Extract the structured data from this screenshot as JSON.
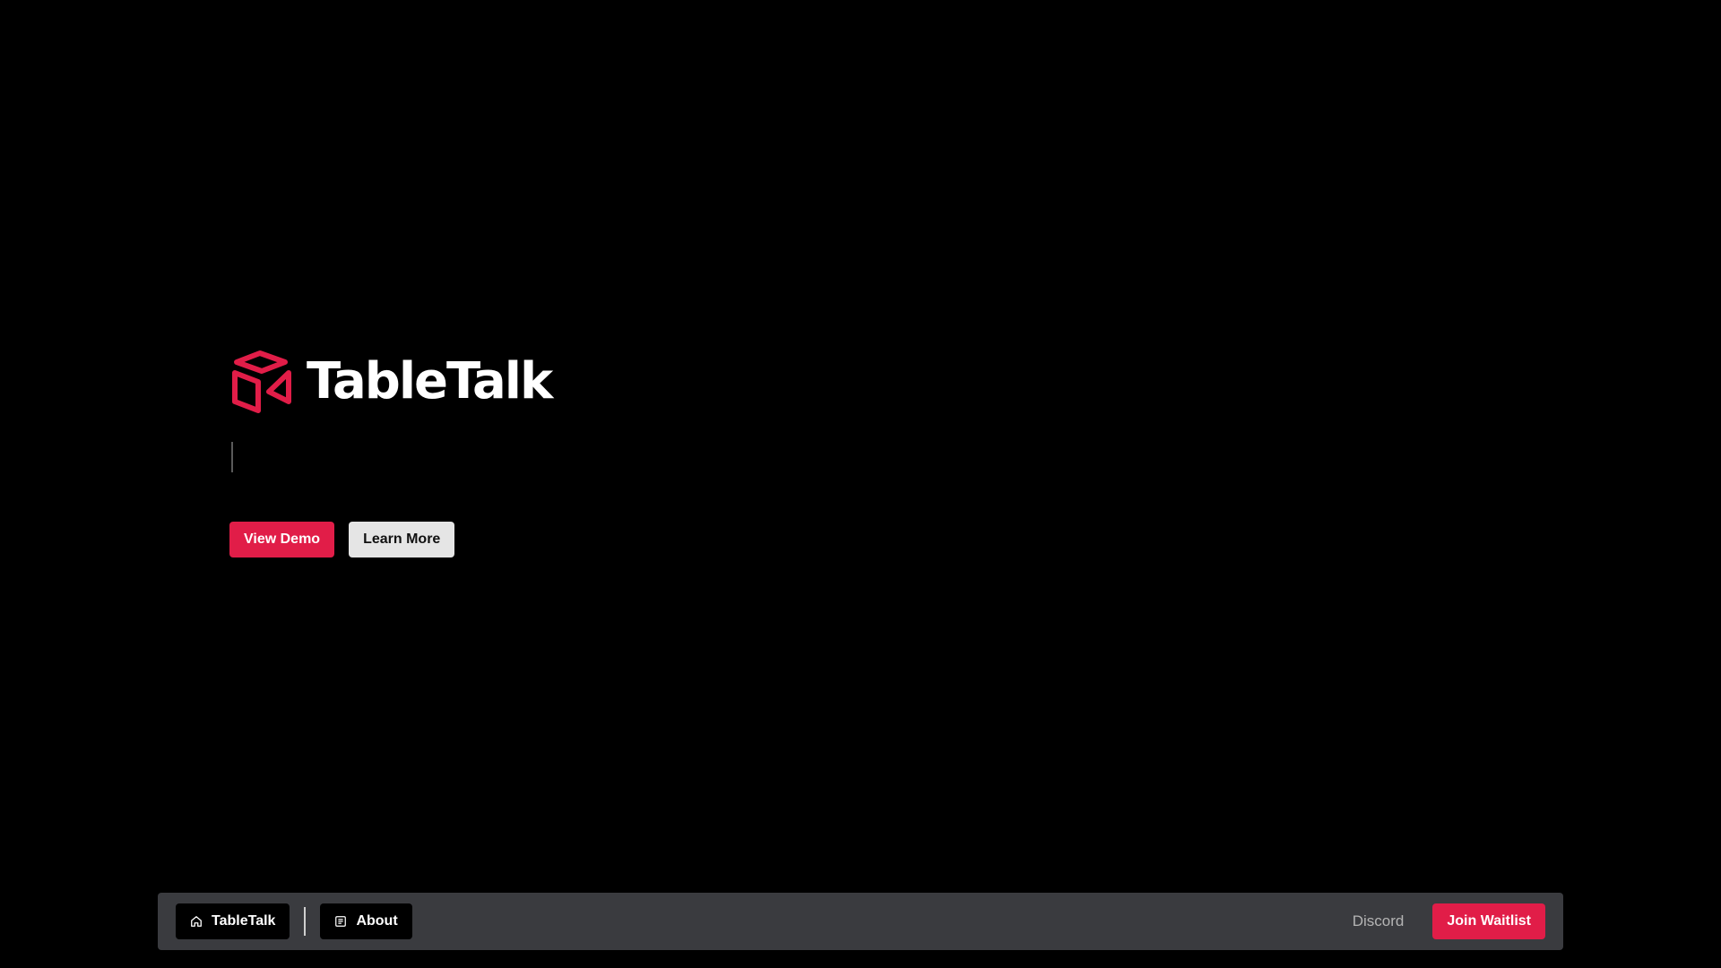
{
  "hero": {
    "title": "TableTalk",
    "logo_icon": "isometric-box-icon",
    "primary_button_label": "View Demo",
    "secondary_button_label": "Learn More"
  },
  "navbar": {
    "home": {
      "label": "TableTalk",
      "icon": "home-icon"
    },
    "about": {
      "label": "About",
      "icon": "newspaper-icon"
    },
    "discord_label": "Discord",
    "cta_label": "Join Waitlist"
  },
  "colors": {
    "background": "#000000",
    "accent": "#e11d48",
    "navbar": "#3a3b3f",
    "secondary_button": "#e5e5e5"
  }
}
